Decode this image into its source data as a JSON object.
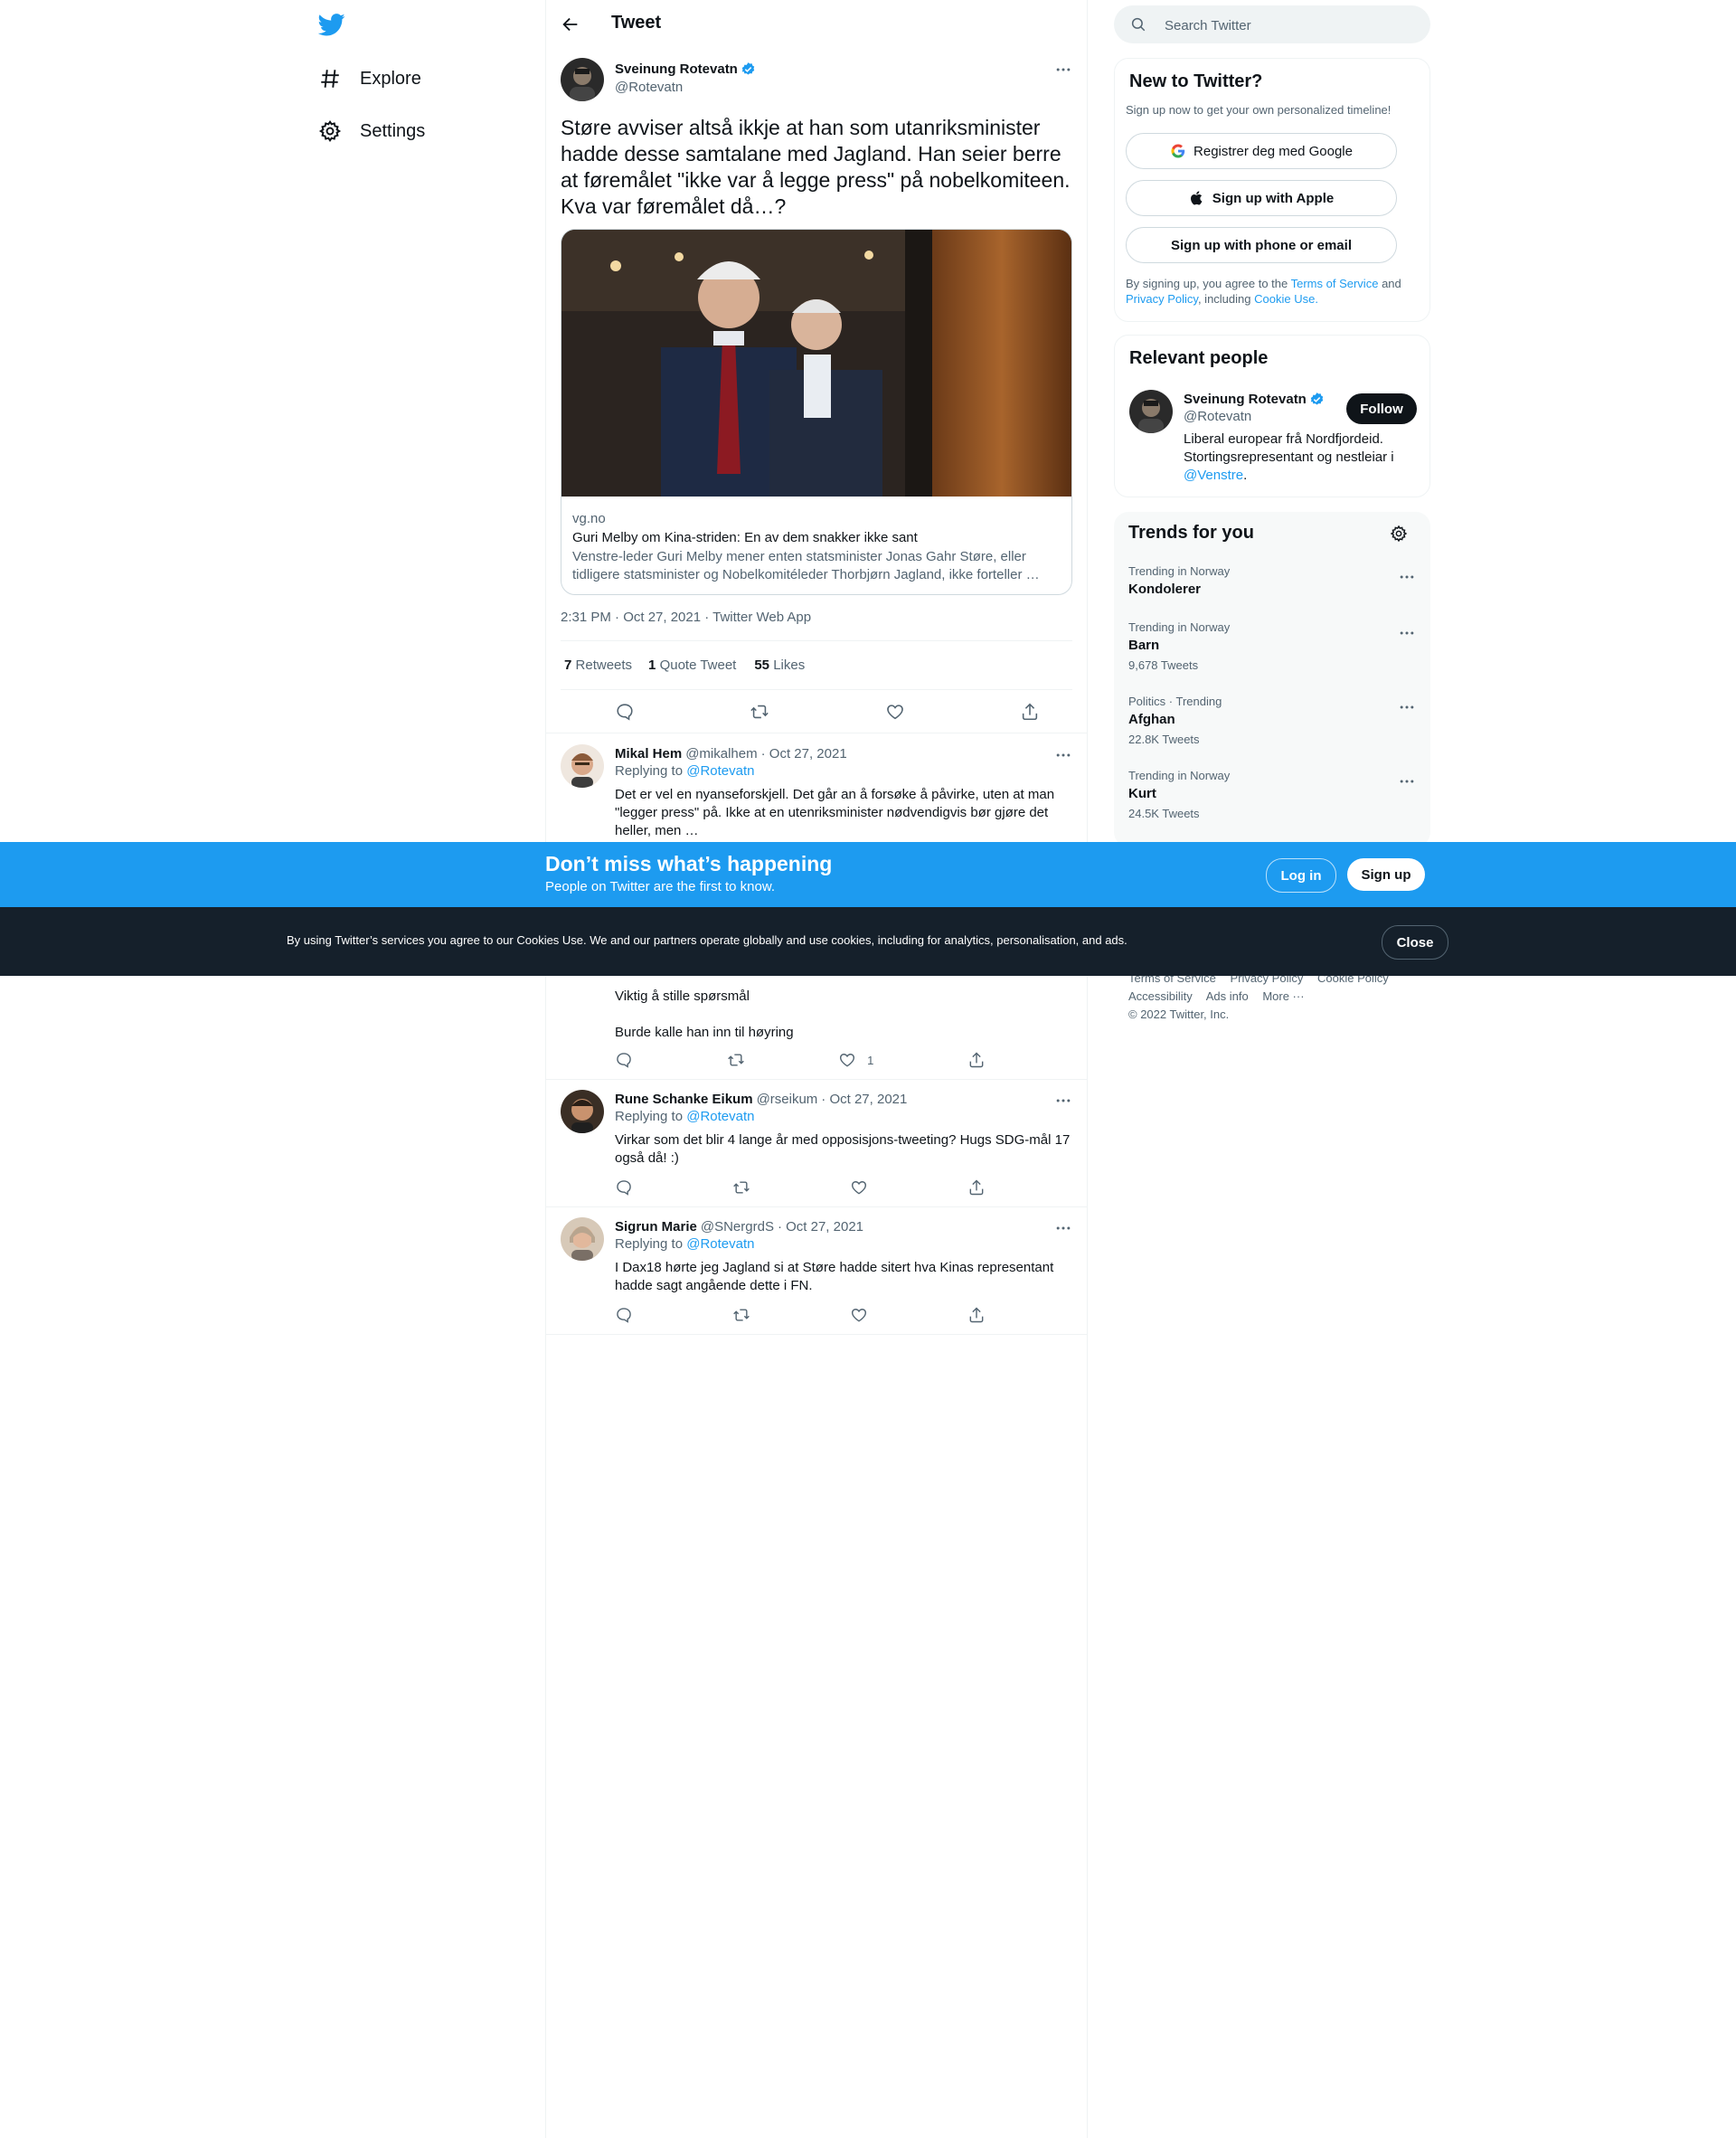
{
  "nav": {
    "logo": "twitter-bird-icon",
    "items": [
      {
        "label": "Explore",
        "icon": "hashtag-icon"
      },
      {
        "label": "Settings",
        "icon": "gear-icon"
      }
    ]
  },
  "header": {
    "title": "Tweet"
  },
  "tweet": {
    "author_name": "Sveinung Rotevatn",
    "author_handle": "@Rotevatn",
    "text": "Støre avviser altså ikkje at han som utanriksminister hadde desse samtalane med Jagland. Han seier berre at føremålet \"ikke var å legge press\" på nobelkomiteen. Kva var føremålet då…?",
    "card": {
      "domain": "vg.no",
      "title": "Guri Melby om Kina-striden: En av dem snakker ikke sant",
      "description": "Venstre-leder Guri Melby mener enten statsminister Jonas Gahr Støre, eller tidligere statsminister og Nobelkomitéleder Thorbjørn Jagland, ikke forteller …"
    },
    "meta": "2:31 PM · Oct 27, 2021 · Twitter Web App",
    "stats": {
      "retweets_count": "7",
      "retweets_label": "Retweets",
      "quotes_count": "1",
      "quotes_label": "Quote Tweet",
      "likes_count": "55",
      "likes_label": "Likes"
    }
  },
  "replies": [
    {
      "name": "Mikal Hem",
      "handle": "@mikalhem",
      "date": "· Oct 27, 2021",
      "replying_prefix": "Replying to",
      "replying_to": "@Rotevatn",
      "text": "Det er vel en nyanseforskjell. Det går an å forsøke å påvirke, uten at man \"legger press\" på. Ikke at en utenriksminister nødvendigvis bør gjøre det heller, men …"
    },
    {
      "text_line_1": "Viktig å stille spørsmål",
      "text_line_2": "Burde kalle han inn til høyring",
      "like_count": "1"
    },
    {
      "name": "Rune Schanke Eikum",
      "handle": "@rseikum",
      "date": "· Oct 27, 2021",
      "replying_prefix": "Replying to",
      "replying_to": "@Rotevatn",
      "text": "Virkar som det blir 4 lange år med opposisjons-tweeting? Hugs SDG-mål 17 også då! :)"
    },
    {
      "name": "Sigrun Marie",
      "handle": "@SNergrdS",
      "date": "· Oct 27, 2021",
      "replying_prefix": "Replying to",
      "replying_to": "@Rotevatn",
      "text": "I Dax18 hørte jeg Jagland si at Støre hadde sitert hva Kinas representant hadde sagt angående dette i FN."
    }
  ],
  "search": {
    "placeholder": "Search Twitter"
  },
  "signup_panel": {
    "title": "New to Twitter?",
    "subtitle": "Sign up now to get your own personalized timeline!",
    "google_label": "Registrer deg med Google",
    "apple_label": "Sign up with Apple",
    "phone_label": "Sign up with phone or email",
    "legal_1": "By signing up, you agree to the",
    "terms": "Terms of Service",
    "legal_and": "and",
    "privacy": "Privacy Policy",
    "legal_including": ", including",
    "cookie": "Cookie Use."
  },
  "relevant_people": {
    "title": "Relevant people",
    "name": "Sveinung Rotevatn",
    "handle": "@Rotevatn",
    "follow_label": "Follow",
    "bio": "Liberal europear frå Nordfjordeid. Stortingsrepresentant og nestleiar i",
    "bio_link": "@Venstre",
    "bio_end": "."
  },
  "trends": {
    "title": "Trends for you",
    "items": [
      {
        "context": "Trending in Norway",
        "name": "Kondolerer",
        "count": ""
      },
      {
        "context": "Trending in Norway",
        "name": "Barn",
        "count": "9,678 Tweets"
      },
      {
        "context": "Politics · Trending",
        "name": "Afghan",
        "count": "22.8K Tweets"
      },
      {
        "context": "Trending in Norway",
        "name": "Kurt",
        "count": "24.5K Tweets"
      }
    ]
  },
  "footer": {
    "links_row1": [
      "Terms of Service",
      "Privacy Policy",
      "Cookie Policy"
    ],
    "links_row2": [
      "Accessibility",
      "Ads info",
      "More ···"
    ],
    "copyright": "© 2022 Twitter, Inc."
  },
  "bottom_bar": {
    "title": "Don’t miss what’s happening",
    "subtitle": "People on Twitter are the first to know.",
    "login_label": "Log in",
    "signup_label": "Sign up"
  },
  "cookie_bar": {
    "text": "By using Twitter’s services you agree to our Cookies Use. We and our partners operate globally and use cookies, including for analytics, personalisation, and ads.",
    "close_label": "Close"
  },
  "colors": {
    "accent": "#1d9bf0",
    "text": "#0f1419",
    "secondary": "#536471",
    "cookie_bg": "#15202b"
  }
}
